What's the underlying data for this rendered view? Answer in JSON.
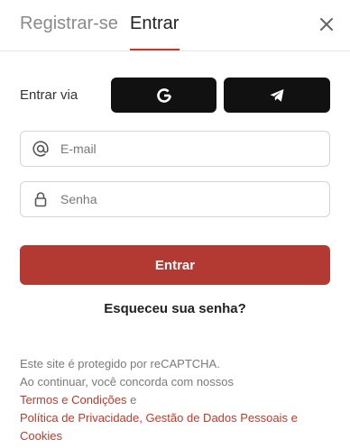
{
  "tabs": {
    "register_label": "Registrar-se",
    "login_label": "Entrar"
  },
  "close_icon": "close-icon",
  "social": {
    "via_label": "Entrar via",
    "google_icon": "google-icon",
    "telegram_icon": "telegram-icon"
  },
  "form": {
    "email_placeholder": "E-mail",
    "email_value": "",
    "password_placeholder": "Senha",
    "password_value": "",
    "submit_label": "Entrar",
    "forgot_label": "Esqueceu sua senha?"
  },
  "notice": {
    "line1": "Este site é protegido por reCAPTCHA.",
    "line2": "Ao continuar, você concorda com nossos",
    "terms_link": "Termos e Condições",
    "and_text": " e",
    "privacy_link": "Política de Privacidade, Gestão de Dados Pessoais e Cookies"
  },
  "colors": {
    "accent": "#b33a32",
    "social_button_bg": "#111111",
    "link": "#c0392b"
  }
}
